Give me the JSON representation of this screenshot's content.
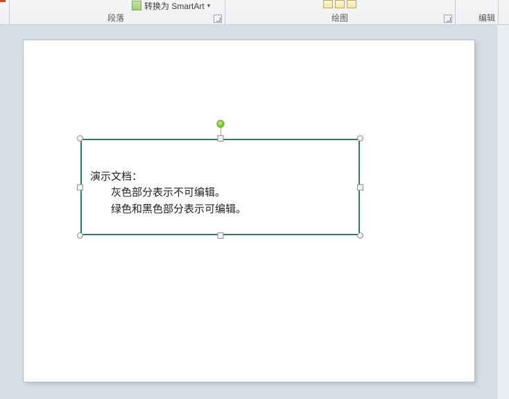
{
  "ribbon": {
    "smartart_label": "转换为 SmartArt",
    "groups": {
      "paragraph": {
        "label": "段落"
      },
      "drawing": {
        "label": "绘图"
      },
      "editing": {
        "label": "编辑"
      }
    }
  },
  "slide": {
    "textbox": {
      "lines": [
        "演示文档：",
        "灰色部分表示不可编辑。",
        "绿色和黑色部分表示可编辑。"
      ]
    }
  },
  "colors": {
    "textbox_border": "#2b7a63",
    "workspace_bg": "#d5dde5",
    "rotate_handle": "#5bbf1f"
  }
}
